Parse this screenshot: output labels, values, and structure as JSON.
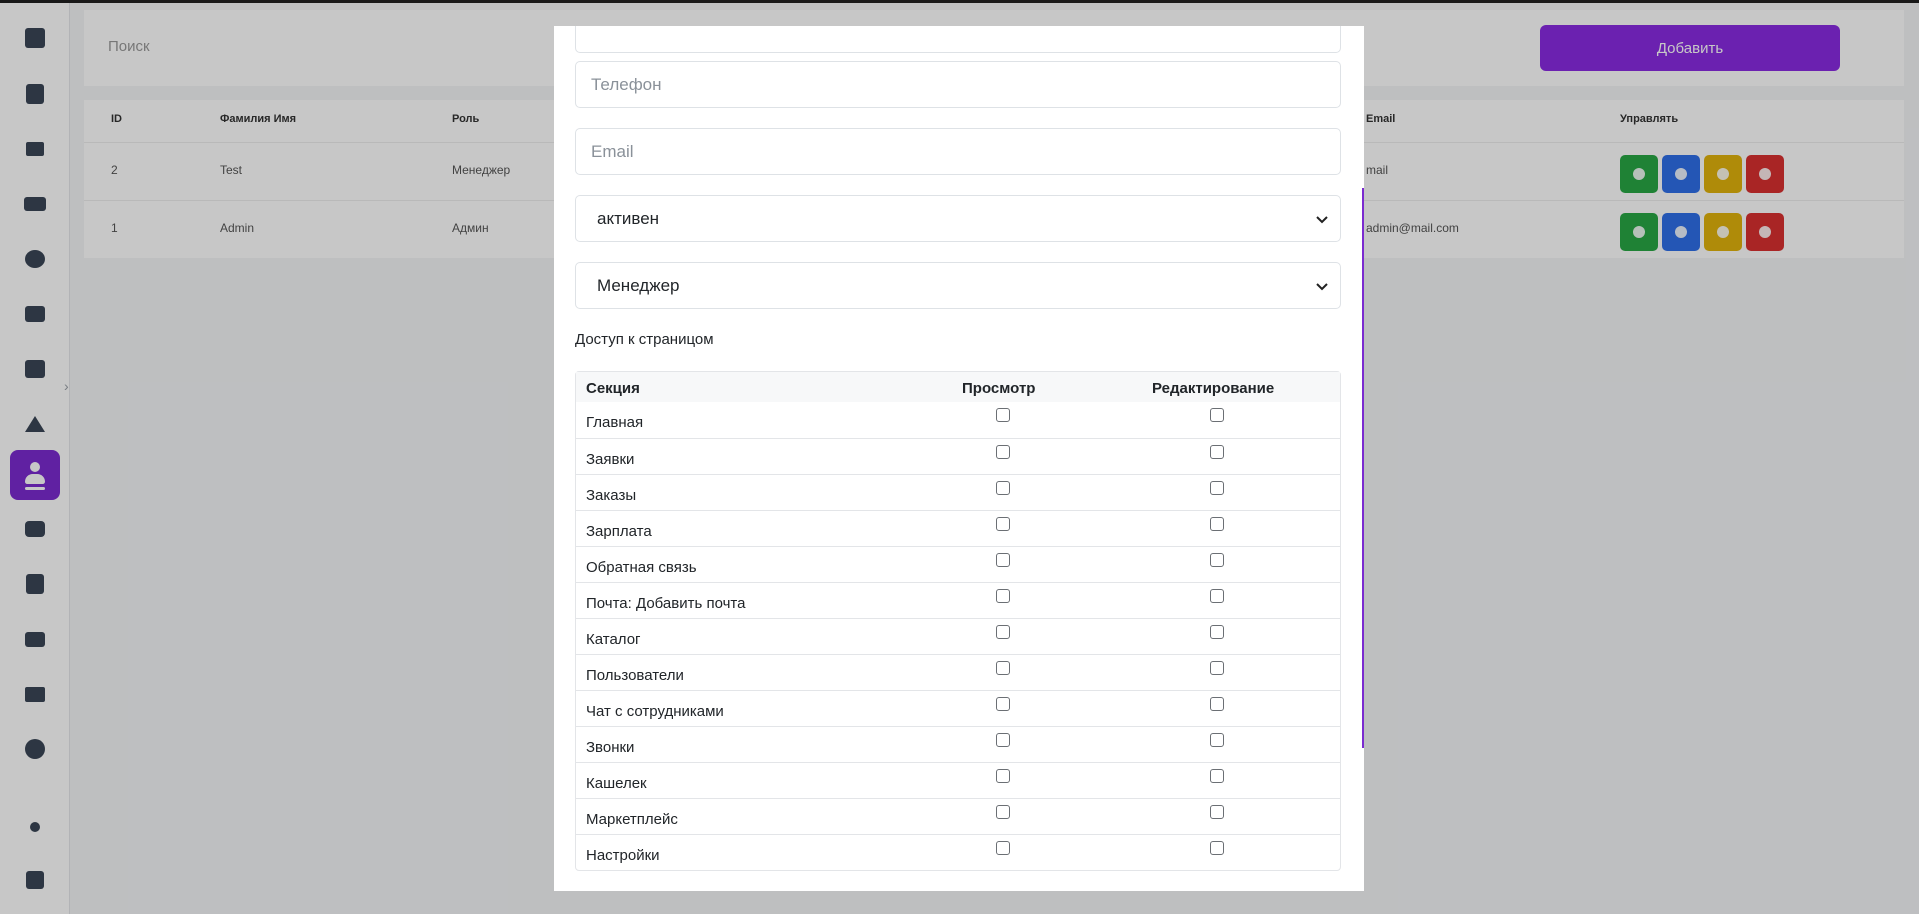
{
  "background": {
    "search_placeholder": "Поиск",
    "add_button": "Добавить",
    "table": {
      "columns": [
        "ID",
        "Фамилия Имя",
        "Роль",
        "Email",
        "Управлять"
      ],
      "rows": [
        {
          "id": "2",
          "name": "Test",
          "role": "Менеджер",
          "email": "mail"
        },
        {
          "id": "1",
          "name": "Admin",
          "role": "Админ",
          "email": "admin@mail.com"
        }
      ]
    }
  },
  "modal": {
    "phone_placeholder": "Телефон",
    "email_placeholder": "Email",
    "status_value": "активен",
    "role_value": "Менеджер",
    "access_label": "Доступ к страницом",
    "table_headers": {
      "section": "Секция",
      "view": "Просмотр",
      "edit": "Редактирование"
    },
    "sections": [
      "Главная",
      "Заявки",
      "Заказы",
      "Зарплата",
      "Обратная связь",
      "Почта: Добавить почта",
      "Каталог",
      "Пользователи",
      "Чат с сотрудниками",
      "Звонки",
      "Кашелек",
      "Маркетплейс",
      "Настройки"
    ]
  },
  "colors": {
    "accent": "#7b2bd0",
    "green": "#28a745",
    "blue": "#2f6fe8",
    "yellow": "#e0b20c",
    "red": "#d93030"
  }
}
